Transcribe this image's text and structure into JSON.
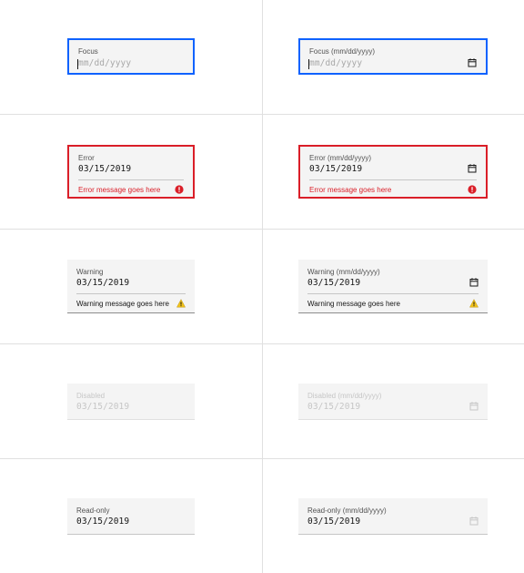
{
  "colors": {
    "focus_border": "#0f62fe",
    "error": "#da1e28",
    "warning_icon": "#f1c21b",
    "field_bg": "#f4f4f4",
    "disabled_text": "#c6c6c6"
  },
  "rows": {
    "focus": {
      "left": {
        "label": "Focus",
        "placeholder": "mm/dd/yyyy"
      },
      "right": {
        "label": "Focus (mm/dd/yyyy)",
        "placeholder": "mm/dd/yyyy",
        "icon": "calendar-icon"
      }
    },
    "error": {
      "left": {
        "label": "Error",
        "value": "03/15/2019",
        "message": "Error message goes here",
        "icon": "error-icon"
      },
      "right": {
        "label": "Error (mm/dd/yyyy)",
        "value": "03/15/2019",
        "message": "Error message goes here",
        "icon": "calendar-icon"
      }
    },
    "warning": {
      "left": {
        "label": "Warning",
        "value": "03/15/2019",
        "message": "Warning message goes here",
        "icon": "warning-icon"
      },
      "right": {
        "label": "Warning (mm/dd/yyyy)",
        "value": "03/15/2019",
        "message": "Warning message goes here",
        "icon": "calendar-icon"
      }
    },
    "disabled": {
      "left": {
        "label": "Disabled",
        "value": "03/15/2019"
      },
      "right": {
        "label": "Disabled (mm/dd/yyyy)",
        "value": "03/15/2019",
        "icon": "calendar-icon"
      }
    },
    "readonly": {
      "left": {
        "label": "Read-only",
        "value": "03/15/2019"
      },
      "right": {
        "label": "Read-only (mm/dd/yyyy)",
        "value": "03/15/2019",
        "icon": "calendar-icon"
      }
    }
  }
}
